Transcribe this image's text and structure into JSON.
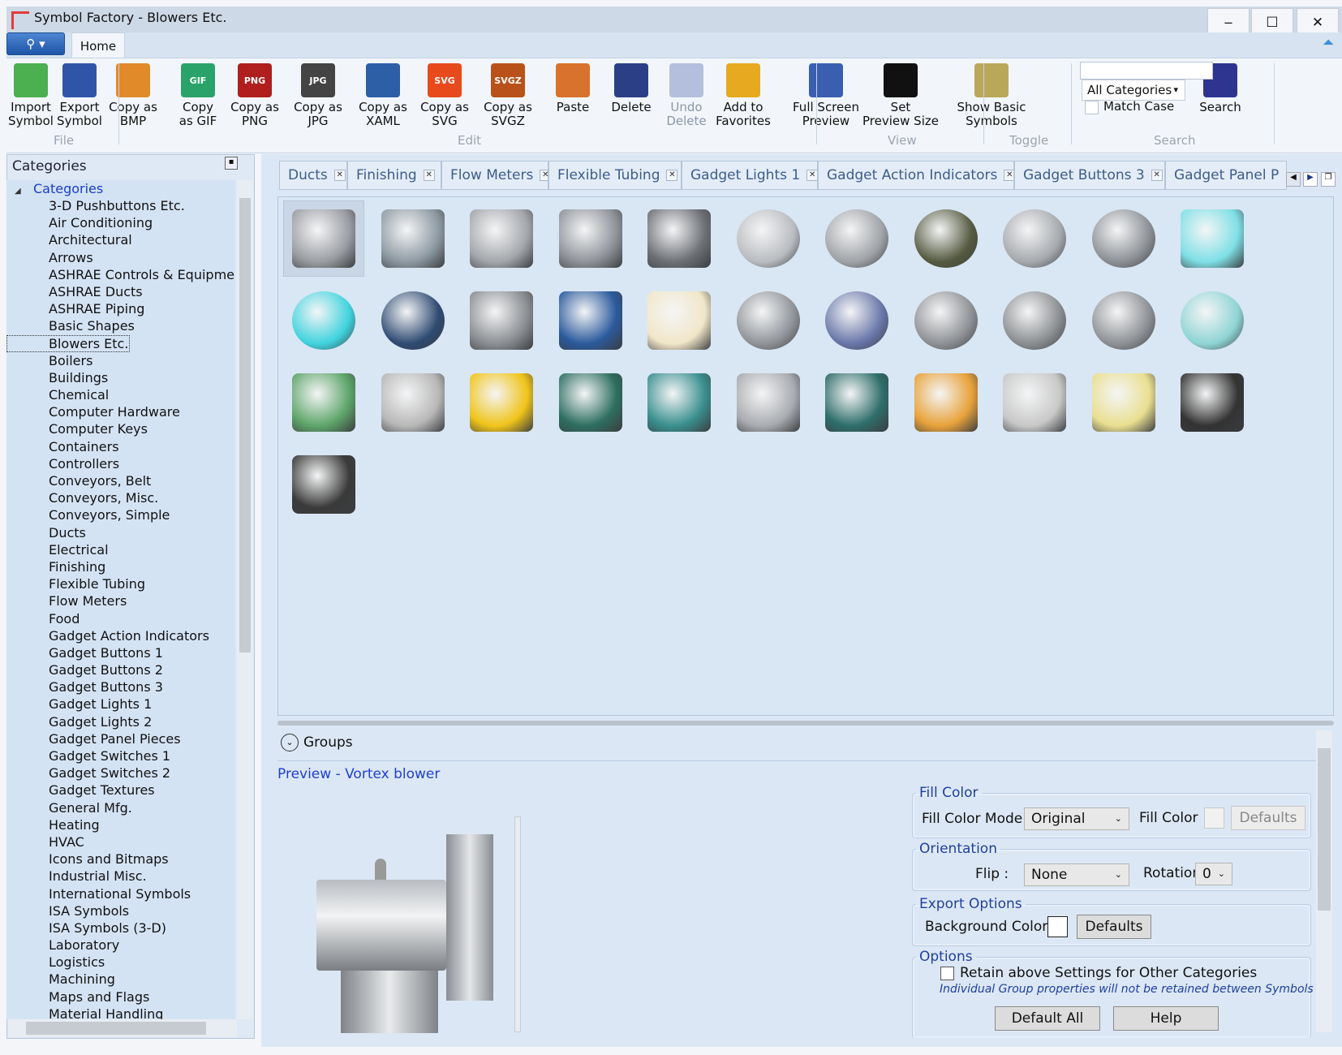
{
  "window": {
    "title": "Symbol Factory - Blowers Etc.",
    "minimize": "‒",
    "maximize": "☐",
    "close": "✕"
  },
  "ribbon": {
    "tab": "Home",
    "groups": {
      "file": "File",
      "edit": "Edit",
      "view": "View",
      "toggle": "Toggle",
      "search": "Search"
    },
    "buttons": [
      {
        "l1": "Import",
        "l2": "Symbol",
        "icon": "import-icon",
        "color": "#4caf50"
      },
      {
        "l1": "Export",
        "l2": "Symbol",
        "icon": "export-icon",
        "color": "#2f55a8"
      },
      {
        "l1": "Copy as",
        "l2": "BMP",
        "icon": "palette-icon",
        "color": "#e08a2a"
      },
      {
        "l1": "Copy",
        "l2": "as GIF",
        "icon": "gif-file-icon",
        "color": "#2aa36a",
        "tag": "GIF"
      },
      {
        "l1": "Copy as",
        "l2": "PNG",
        "icon": "png-file-icon",
        "color": "#b01e1e",
        "tag": "PNG"
      },
      {
        "l1": "Copy as",
        "l2": "JPG",
        "icon": "jpg-file-icon",
        "color": "#444",
        "tag": "JPG"
      },
      {
        "l1": "Copy as",
        "l2": "XAML",
        "icon": "xaml-icon",
        "color": "#2d5fa6"
      },
      {
        "l1": "Copy as",
        "l2": "SVG",
        "icon": "svg-file-icon",
        "color": "#e84a1c",
        "tag": "SVG"
      },
      {
        "l1": "Copy as",
        "l2": "SVGZ",
        "icon": "svgz-file-icon",
        "color": "#b8521a",
        "tag": "SVGZ"
      },
      {
        "l1": "Paste",
        "l2": "",
        "icon": "paste-icon",
        "color": "#d9722c"
      },
      {
        "l1": "Delete",
        "l2": "",
        "icon": "trash-icon",
        "color": "#2b3f86"
      },
      {
        "l1": "Undo",
        "l2": "Delete",
        "icon": "undo-delete-icon",
        "color": "#b3bfdc",
        "disabled": true
      },
      {
        "l1": "Add to",
        "l2": "Favorites",
        "icon": "star-icon",
        "color": "#e6a920"
      },
      {
        "l1": "Full Screen",
        "l2": "Preview",
        "icon": "fullscreen-icon",
        "color": "#3a5fb0"
      },
      {
        "l1": "Set",
        "l2": "Preview Size",
        "icon": "camera-icon",
        "color": "#111"
      },
      {
        "l1": "Show Basic",
        "l2": "Symbols",
        "icon": "toggle-symbols-icon",
        "color": "#b9a85a"
      },
      {
        "l1": "Search",
        "l2": "",
        "icon": "magnifier-icon",
        "color": "#2e3591"
      }
    ],
    "search_value": "",
    "category_select": "All Categories",
    "match_case": "Match Case"
  },
  "sidebar": {
    "title": "Categories",
    "root": "Categories",
    "selected": "Blowers Etc.",
    "items": [
      "3-D Pushbuttons Etc.",
      "Air Conditioning",
      "Architectural",
      "Arrows",
      "ASHRAE Controls & Equipme",
      "ASHRAE Ducts",
      "ASHRAE Piping",
      "Basic Shapes",
      "Blowers Etc.",
      "Boilers",
      "Buildings",
      "Chemical",
      "Computer Hardware",
      "Computer Keys",
      "Containers",
      "Controllers",
      "Conveyors, Belt",
      "Conveyors, Misc.",
      "Conveyors, Simple",
      "Ducts",
      "Electrical",
      "Finishing",
      "Flexible Tubing",
      "Flow Meters",
      "Food",
      "Gadget Action Indicators",
      "Gadget Buttons 1",
      "Gadget Buttons 2",
      "Gadget Buttons 3",
      "Gadget Lights 1",
      "Gadget Lights 2",
      "Gadget Panel Pieces",
      "Gadget Switches 1",
      "Gadget Switches 2",
      "Gadget Textures",
      "General Mfg.",
      "Heating",
      "HVAC",
      "Icons and Bitmaps",
      "Industrial Misc.",
      "International Symbols",
      "ISA Symbols",
      "ISA Symbols (3-D)",
      "Laboratory",
      "Logistics",
      "Machining",
      "Maps and Flags",
      "Material Handling"
    ]
  },
  "tabs": [
    "Ducts",
    "Finishing",
    "Flow Meters",
    "Flexible Tubing",
    "Gadget Lights 1",
    "Gadget Action Indicators",
    "Gadget Buttons 3",
    "Gadget Panel P"
  ],
  "symbols": [
    "#9a9da2",
    "#8e9aa3",
    "#a4a7ab",
    "#8f9399",
    "#6d7075",
    "#b9bcc0",
    "#9fa2a6",
    "#555a40",
    "#a6a9ad",
    "#8c9095",
    "#7fe0e6",
    "#3fd3de",
    "#2e4a72",
    "#8b8e92",
    "#2b5a9c",
    "#f1e6c8",
    "#8f9398",
    "#6875a8",
    "#8d9094",
    "#8a8d90",
    "#8d9094",
    "#8fd4d4",
    "#5ea56a",
    "#b8b8b8",
    "#f0c419",
    "#2e6f60",
    "#3a8f8f",
    "#a9acb0",
    "#2e6e6a",
    "#e8a23a",
    "#c8c8c8",
    "#e9df90",
    "#333333",
    "#3a3a3a"
  ],
  "groups": {
    "label": "Groups"
  },
  "preview": {
    "title": "Preview - Vortex blower"
  },
  "props": {
    "fill_color": {
      "legend": "Fill Color",
      "mode_label": "Fill Color Mode",
      "mode_value": "Original",
      "color_label": "Fill Color",
      "defaults": "Defaults"
    },
    "orientation": {
      "legend": "Orientation",
      "flip_label": "Flip :",
      "flip_value": "None",
      "rotation_label": "Rotation :",
      "rotation_value": "0"
    },
    "export": {
      "legend": "Export Options",
      "bg_label": "Background Color :",
      "defaults": "Defaults"
    },
    "options": {
      "legend": "Options",
      "retain": "Retain above Settings for Other Categories",
      "note": "Individual Group properties will not be retained between Symbols",
      "default_all": "Default All",
      "help": "Help"
    }
  }
}
